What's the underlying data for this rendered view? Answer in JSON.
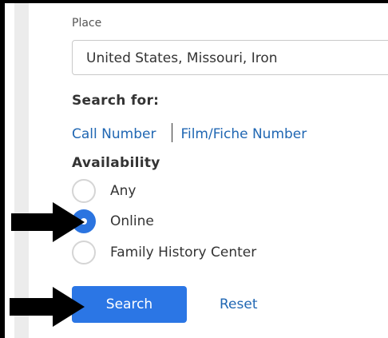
{
  "place": {
    "label": "Place",
    "value": "United States, Missouri, Iron"
  },
  "search_for": {
    "heading": "Search for:",
    "call_number_link": "Call Number",
    "film_fiche_link": "Film/Fiche Number"
  },
  "availability": {
    "heading": "Availability",
    "options": [
      {
        "label": "Any",
        "checked": false
      },
      {
        "label": "Online",
        "checked": true
      },
      {
        "label": "Family History Center",
        "checked": false
      }
    ]
  },
  "actions": {
    "search_label": "Search",
    "reset_label": "Reset"
  },
  "colors": {
    "primary_blue": "#2b76e5",
    "link_blue": "#2067b3",
    "annotation_arrow": "#000000"
  },
  "annotations": {
    "arrow_icons": [
      "arrow-right-icon",
      "arrow-right-icon"
    ]
  }
}
